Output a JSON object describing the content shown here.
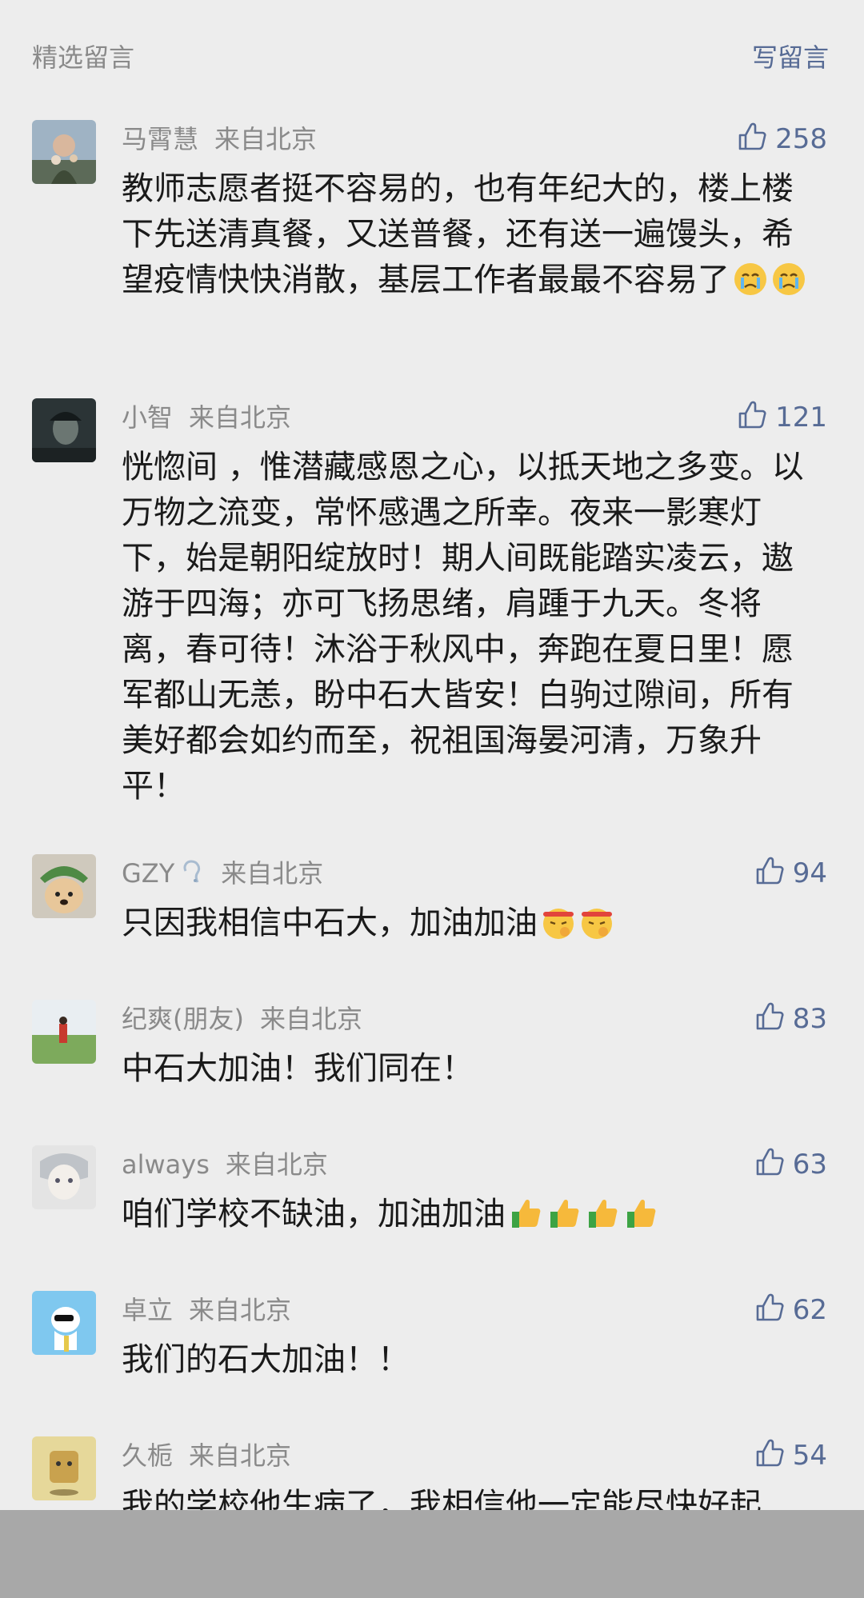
{
  "header": {
    "section_title": "精选留言",
    "write_label": "写留言"
  },
  "colors": {
    "accent": "#576b95",
    "meta": "#8a8a8a",
    "background": "#ededed"
  },
  "comments": [
    {
      "name": "马霄慧",
      "location": "来自北京",
      "likes": "258",
      "text": "教师志愿者挺不容易的，也有年纪大的，楼上楼下先送清真餐，又送普餐，还有送一遍馒头，希望疫情快快消散，基层工作者最最不容易了",
      "emojis": [
        "crying-emoji",
        "crying-emoji"
      ]
    },
    {
      "name": "小智",
      "location": "来自北京",
      "likes": "121",
      "text": "恍惚间 ，惟潜藏感恩之心，以抵天地之多变。以万物之流变，常怀感遇之所幸。夜来一影寒灯下，始是朝阳绽放时！期人间既能踏实凌云，遨游于四海；亦可飞扬思绪，肩踵于九天。冬将离，春可待！沐浴于秋风中，奔跑在夏日里！愿军都山无恙，盼中石大皆安！白驹过隙间，所有美好都会如约而至，祝祖国海晏河清，万象升平！"
    },
    {
      "name": "GZY",
      "badge": "icon-badge",
      "location": "来自北京",
      "likes": "94",
      "text": "只因我相信中石大，加油加油",
      "emojis": [
        "fighting-emoji",
        "fighting-emoji"
      ]
    },
    {
      "name": "纪爽(朋友)",
      "location": "来自北京",
      "likes": "83",
      "text": "中石大加油！我们同在！"
    },
    {
      "name": "always",
      "location": "来自北京",
      "likes": "63",
      "text": "咱们学校不缺油，加油加油",
      "emojis": [
        "thumbs-up-emoji",
        "thumbs-up-emoji",
        "thumbs-up-emoji",
        "thumbs-up-emoji"
      ]
    },
    {
      "name": "卓立",
      "location": "来自北京",
      "likes": "62",
      "text": "我们的石大加油！！"
    },
    {
      "name": "久栀",
      "location": "来自北京",
      "likes": "54",
      "text": "我的学校他生病了，我相信他一定能尽快好起"
    }
  ]
}
